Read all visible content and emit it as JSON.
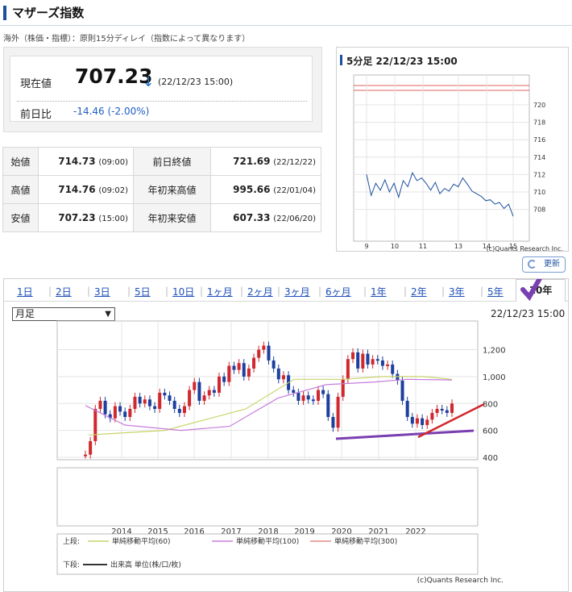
{
  "page": {
    "title": "マザーズ指数",
    "note": "海外（株価・指標）：原則15分ディレイ（指数によって異なります）"
  },
  "current": {
    "label": "現在値",
    "value": "707.23",
    "arrow": "↓",
    "time": "(22/12/23 15:00)",
    "change_label": "前日比",
    "change_value": "-14.46 (-2.00%)"
  },
  "stats": [
    {
      "label": "始値",
      "value": "714.73",
      "time": "(09:00)",
      "label2": "前日終値",
      "value2": "721.69",
      "time2": "(22/12/22)"
    },
    {
      "label": "高値",
      "value": "714.76",
      "time": "(09:02)",
      "label2": "年初来高値",
      "value2": "995.66",
      "time2": "(22/01/04)"
    },
    {
      "label": "安値",
      "value": "707.23",
      "time": "(15:00)",
      "label2": "年初来安値",
      "value2": "607.33",
      "time2": "(22/06/20)"
    }
  ],
  "mini_chart": {
    "title": "5分足 22/12/23 15:00",
    "y_ticks": [
      "720",
      "718",
      "716",
      "714",
      "712",
      "710",
      "708"
    ],
    "x_ticks": [
      "9",
      "10",
      "11",
      "13",
      "14",
      "15"
    ],
    "credit": "(c)Quants Research Inc.",
    "series_color": "#1d4f9e",
    "limit_color": "#e06060"
  },
  "refresh_label": "更新",
  "tabs": [
    "1日",
    "2日",
    "3日",
    "5日",
    "10日",
    "1ヶ月",
    "2ヶ月",
    "3ヶ月",
    "6ヶ月",
    "1年",
    "2年",
    "3年",
    "5年"
  ],
  "active_tab": "10年",
  "period_select": "月足",
  "chart_time": "22/12/23 15:00",
  "main_chart": {
    "y_ticks": [
      "1,200",
      "1,000",
      "800",
      "600",
      "400"
    ],
    "x_ticks": [
      "2014",
      "2015",
      "2016",
      "2017",
      "2018",
      "2019",
      "2020",
      "2021",
      "2022"
    ],
    "legend_upper_label": "上段:",
    "legend_items": [
      "単純移動平均(60)",
      "単純移動平均(100)",
      "単純移動平均(300)"
    ],
    "legend_colors": [
      "#c9d46a",
      "#c77ddb",
      "#e38a8a"
    ],
    "legend_lower_label": "下段:",
    "legend_volume": "出来高 単位(株/口/枚)",
    "credit": "(c)Quants Research Inc.",
    "candle_color": "#1d3f9e",
    "up_color": "#d0282e"
  }
}
